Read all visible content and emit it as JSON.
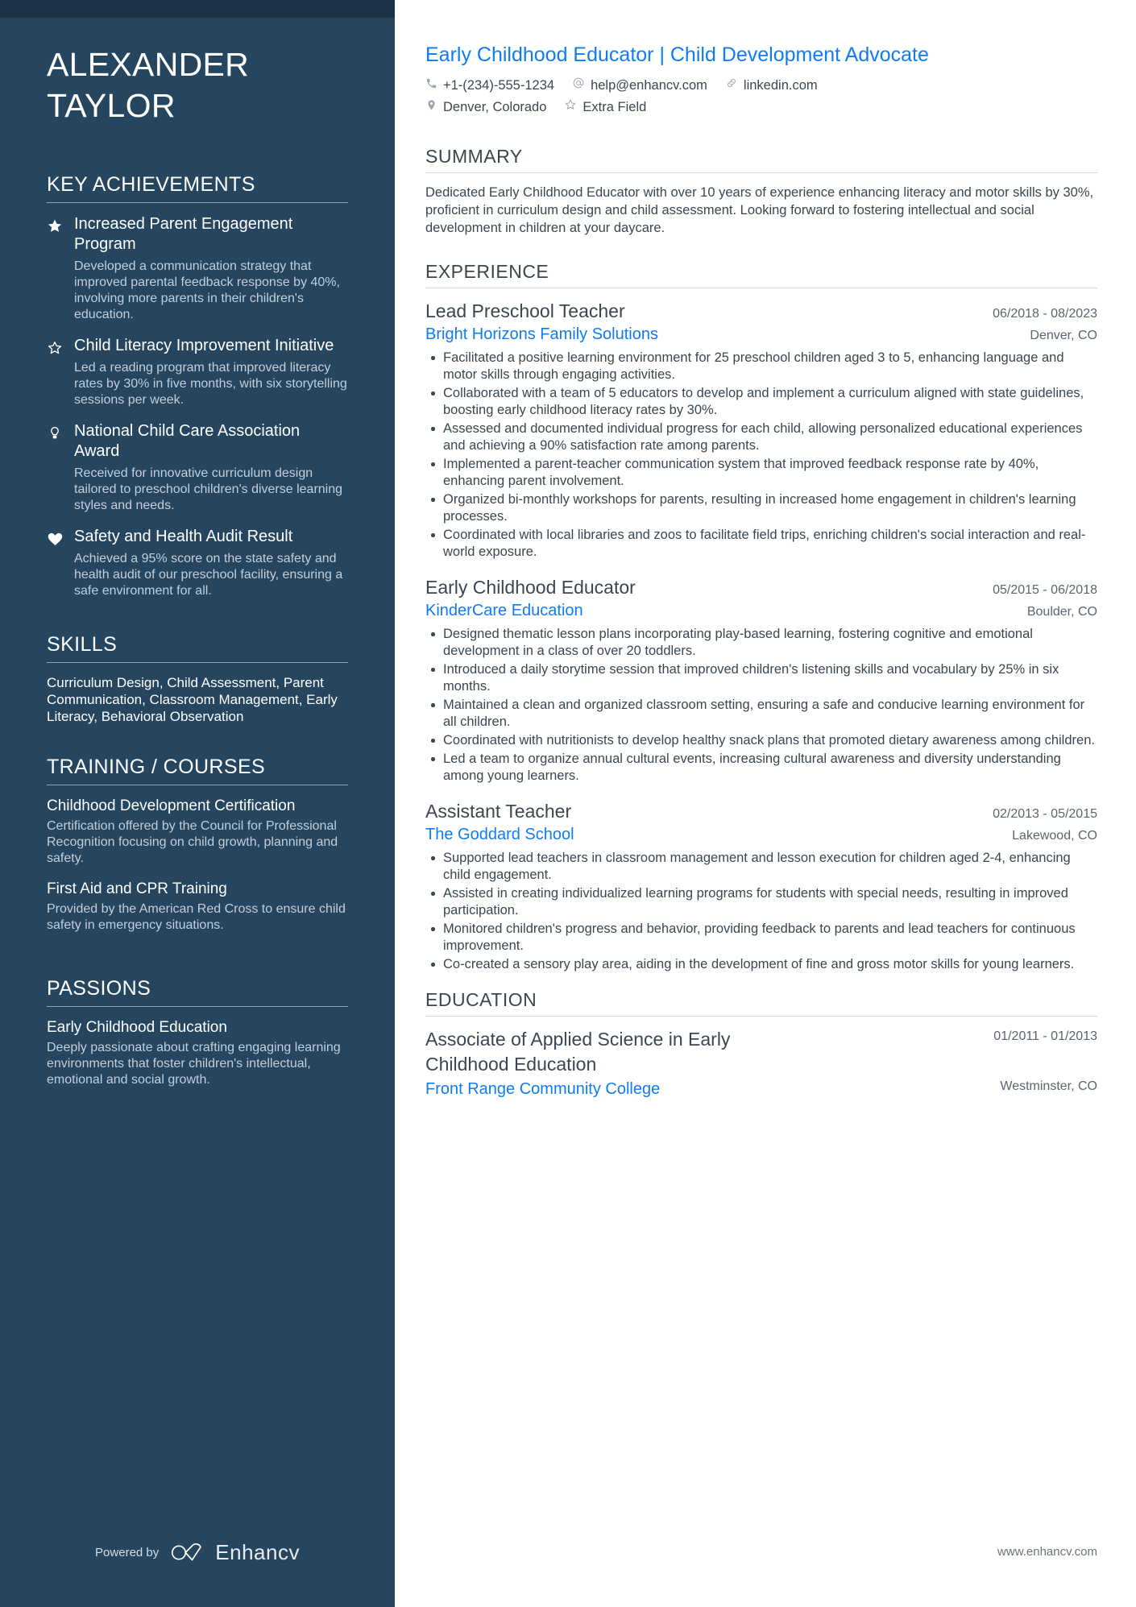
{
  "sidebar": {
    "name_lines": [
      "ALEXANDER",
      "TAYLOR"
    ],
    "achievements_heading": "KEY ACHIEVEMENTS",
    "achievements": [
      {
        "icon": "star-filled-icon",
        "title": "Increased Parent Engagement Program",
        "desc": "Developed a communication strategy that improved parental feedback response by 40%, involving more parents in their children's education."
      },
      {
        "icon": "star-outline-icon",
        "title": "Child Literacy Improvement Initiative",
        "desc": "Led a reading program that improved literacy rates by 30% in five months, with six storytelling sessions per week."
      },
      {
        "icon": "lightbulb-icon",
        "title": "National Child Care Association Award",
        "desc": "Received for innovative curriculum design tailored to preschool children's diverse learning styles and needs."
      },
      {
        "icon": "heart-filled-icon",
        "title": "Safety and Health Audit Result",
        "desc": "Achieved a 95% score on the state safety and health audit of our preschool facility, ensuring a safe environment for all."
      }
    ],
    "skills_heading": "SKILLS",
    "skills_text": "Curriculum Design, Child Assessment, Parent Communication, Classroom Management, Early Literacy, Behavioral Observation",
    "training_heading": "TRAINING / COURSES",
    "courses": [
      {
        "title": "Childhood Development Certification",
        "desc": "Certification offered by the Council for Professional Recognition focusing on child growth, planning and safety."
      },
      {
        "title": "First Aid and CPR Training",
        "desc": "Provided by the American Red Cross to ensure child safety in emergency situations."
      }
    ],
    "passions_heading": "PASSIONS",
    "passions": [
      {
        "title": "Early Childhood Education",
        "desc": "Deeply passionate about crafting engaging learning environments that foster children's intellectual, emotional and social growth."
      }
    ],
    "footer": {
      "powered_by": "Powered by",
      "brand": "Enhancv"
    }
  },
  "main": {
    "headline": "Early Childhood Educator | Child Development Advocate",
    "contacts_row1": [
      {
        "icon": "phone-icon",
        "text": "+1-(234)-555-1234"
      },
      {
        "icon": "at-sign-icon",
        "text": "help@enhancv.com"
      },
      {
        "icon": "link-icon",
        "text": "linkedin.com"
      }
    ],
    "contacts_row2": [
      {
        "icon": "location-pin-icon",
        "text": "Denver, Colorado"
      },
      {
        "icon": "star-outline-icon",
        "text": "Extra Field"
      }
    ],
    "summary_heading": "SUMMARY",
    "summary_text": "Dedicated Early Childhood Educator with over 10 years of experience enhancing literacy and motor skills by 30%, proficient in curriculum design and child assessment. Looking forward to fostering intellectual and social development in children at your daycare.",
    "experience_heading": "EXPERIENCE",
    "jobs": [
      {
        "role": "Lead Preschool Teacher",
        "dates": "06/2018 - 08/2023",
        "company": "Bright Horizons Family Solutions",
        "location": "Denver, CO",
        "bullets": [
          "Facilitated a positive learning environment for 25 preschool children aged 3 to 5, enhancing language and motor skills through engaging activities.",
          "Collaborated with a team of 5 educators to develop and implement a curriculum aligned with state guidelines, boosting early childhood literacy rates by 30%.",
          "Assessed and documented individual progress for each child, allowing personalized educational experiences and achieving a 90% satisfaction rate among parents.",
          "Implemented a parent-teacher communication system that improved feedback response rate by 40%, enhancing parent involvement.",
          "Organized bi-monthly workshops for parents, resulting in increased home engagement in children's learning processes.",
          "Coordinated with local libraries and zoos to facilitate field trips, enriching children's social interaction and real-world exposure."
        ]
      },
      {
        "role": "Early Childhood Educator",
        "dates": "05/2015 - 06/2018",
        "company": "KinderCare Education",
        "location": "Boulder, CO",
        "bullets": [
          "Designed thematic lesson plans incorporating play-based learning, fostering cognitive and emotional development in a class of over 20 toddlers.",
          "Introduced a daily storytime session that improved children's listening skills and vocabulary by 25% in six months.",
          "Maintained a clean and organized classroom setting, ensuring a safe and conducive learning environment for all children.",
          "Coordinated with nutritionists to develop healthy snack plans that promoted dietary awareness among children.",
          "Led a team to organize annual cultural events, increasing cultural awareness and diversity understanding among young learners."
        ]
      },
      {
        "role": "Assistant Teacher",
        "dates": "02/2013 - 05/2015",
        "company": "The Goddard School",
        "location": "Lakewood, CO",
        "bullets": [
          "Supported lead teachers in classroom management and lesson execution for children aged 2-4, enhancing child engagement.",
          "Assisted in creating individualized learning programs for students with special needs, resulting in improved participation.",
          "Monitored children's progress and behavior, providing feedback to parents and lead teachers for continuous improvement.",
          "Co-created a sensory play area, aiding in the development of fine and gross motor skills for young learners."
        ]
      }
    ],
    "education_heading": "EDUCATION",
    "education": [
      {
        "degree": "Associate of Applied Science in Early Childhood Education",
        "dates": "01/2011 - 01/2013",
        "school": "Front Range Community College",
        "location": "Westminster, CO"
      }
    ],
    "footer_url": "www.enhancv.com"
  },
  "colors": {
    "sidebar_bg": "#26455f",
    "sidebar_topbar": "#1c3247",
    "accent_blue": "#0f7cf0",
    "body_text": "#3a4652"
  }
}
